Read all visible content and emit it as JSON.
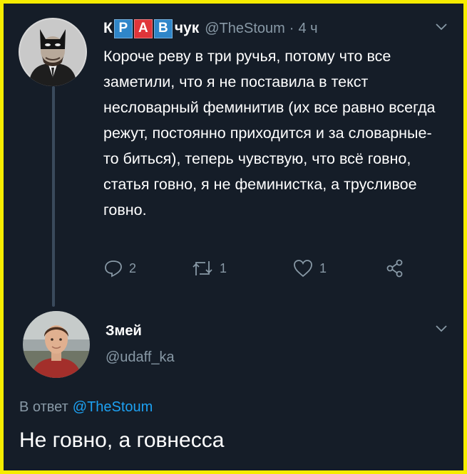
{
  "tweet": {
    "author_name": {
      "prefix": "К",
      "tiles": [
        {
          "letter": "Р",
          "color": "#2f86c9"
        },
        {
          "letter": "А",
          "color": "#e0353a"
        },
        {
          "letter": "В",
          "color": "#2f86c9"
        }
      ],
      "suffix": "чук"
    },
    "handle": "@TheStoum",
    "time": "4 ч",
    "separator": "·",
    "text": "Короче реву в три ручья, потому что все заметили, что я не поставила в текст несловарный феминитив (их все равно всегда режут, постоянно приходится и за словарные-то биться), теперь чувствую, что всё говно, статья говно, я не феминистка, а трусливое говно.",
    "counts": {
      "replies": "2",
      "retweets": "1",
      "likes": "1"
    },
    "icons": {
      "reply": "reply-icon",
      "retweet": "retweet-icon",
      "like": "heart-icon",
      "share": "share-icon",
      "menu": "chevron-down-icon"
    }
  },
  "reply": {
    "author_name": "Змей",
    "handle": "@udaff_ka",
    "reply_to_label": "В ответ",
    "reply_to_handle": "@TheStoum",
    "text": "Не говно, а говнесса"
  },
  "colors": {
    "background": "#151d28",
    "frame_border": "#f6ec00",
    "secondary_text": "#8899a6",
    "link": "#1da1f2"
  }
}
